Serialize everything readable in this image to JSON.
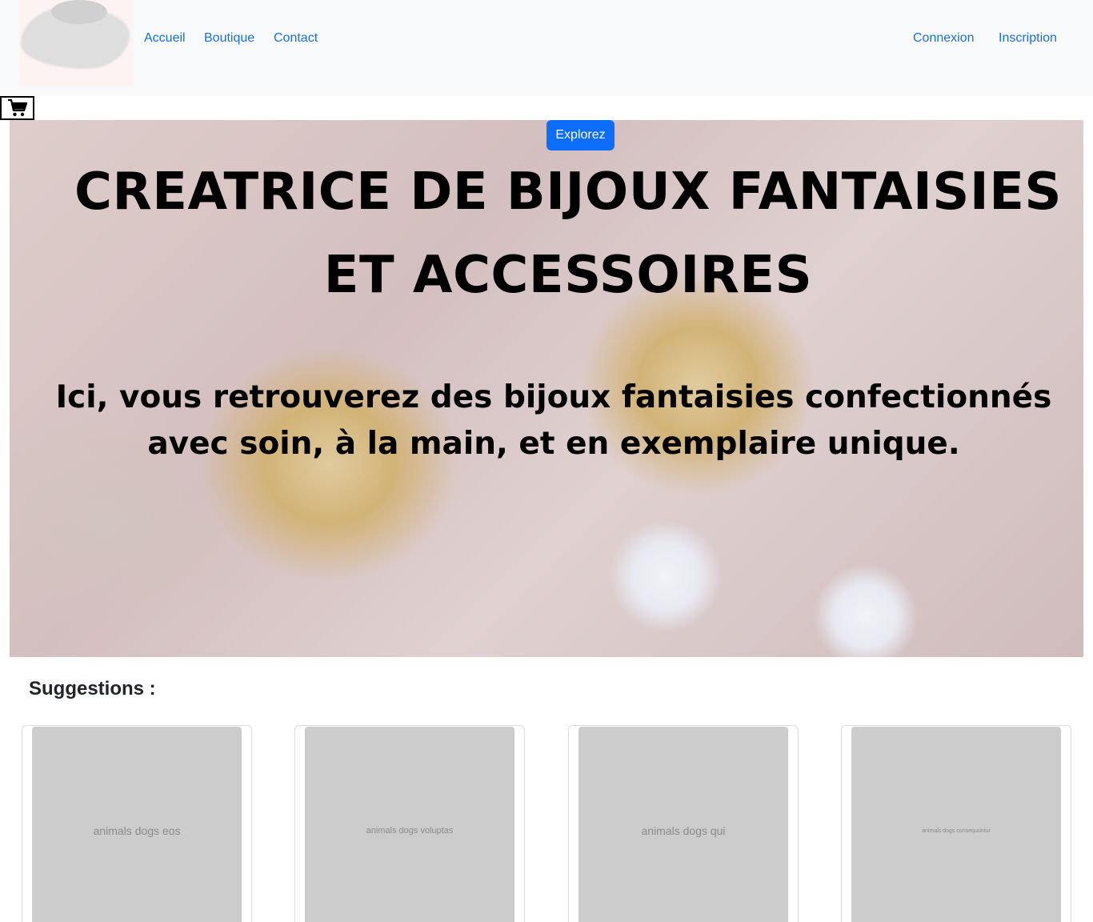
{
  "nav": {
    "links": [
      "Accueil",
      "Boutique",
      "Contact"
    ],
    "auth": [
      "Connexion",
      "Inscription"
    ]
  },
  "icons": {
    "cart": "shopping-cart-icon",
    "logo": "brand-logo"
  },
  "colors": {
    "link": "#1a6fd8",
    "primary_button": "#0d6efd",
    "navbar_bg": "#f8f9fa",
    "placeholder": "#cccccc"
  },
  "hero": {
    "button_label": "Explorez",
    "title": "CREATRICE DE BIJOUX FANTAISIES ET ACCESSOIRES",
    "subtitle": "Ici, vous retrouverez des bijoux fantaisies confectionnés avec soin, à la main, et en exemplaire unique."
  },
  "suggestions": {
    "title": "Suggestions :",
    "cards": [
      {
        "image_label": "animals dogs eos"
      },
      {
        "image_label": "animals dogs voluptas"
      },
      {
        "image_label": "animals dogs qui"
      },
      {
        "image_label": "animals dogs consequuntur"
      }
    ]
  }
}
